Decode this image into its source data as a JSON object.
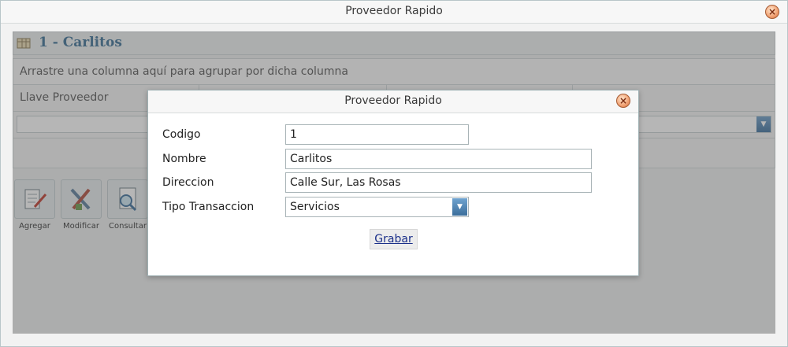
{
  "window": {
    "title": "Proveedor Rapido"
  },
  "panel": {
    "title": "1 - Carlitos",
    "group_hint": "Arrastre una columna aquí para agrupar por dicha columna"
  },
  "grid": {
    "columns": [
      "Llave Proveedor",
      "",
      "",
      ""
    ]
  },
  "toolbar": {
    "agregar": "Agregar",
    "modificar": "Modificar",
    "consultar": "Consultar"
  },
  "dialog": {
    "title": "Proveedor Rapido",
    "fields": {
      "codigo_label": "Codigo",
      "codigo_value": "1",
      "nombre_label": "Nombre",
      "nombre_value": "Carlitos",
      "direccion_label": "Direccion",
      "direccion_value": "Calle Sur, Las Rosas",
      "tipo_label": "Tipo Transaccion",
      "tipo_value": "Servicios"
    },
    "save_label": "Grabar"
  },
  "icons": {
    "close": "close-icon",
    "dropdown": "chevron-down-icon",
    "panel": "table-icon"
  },
  "colors": {
    "accent": "#3a6e94",
    "close": "#d66a36",
    "link": "#1a2f8a"
  }
}
